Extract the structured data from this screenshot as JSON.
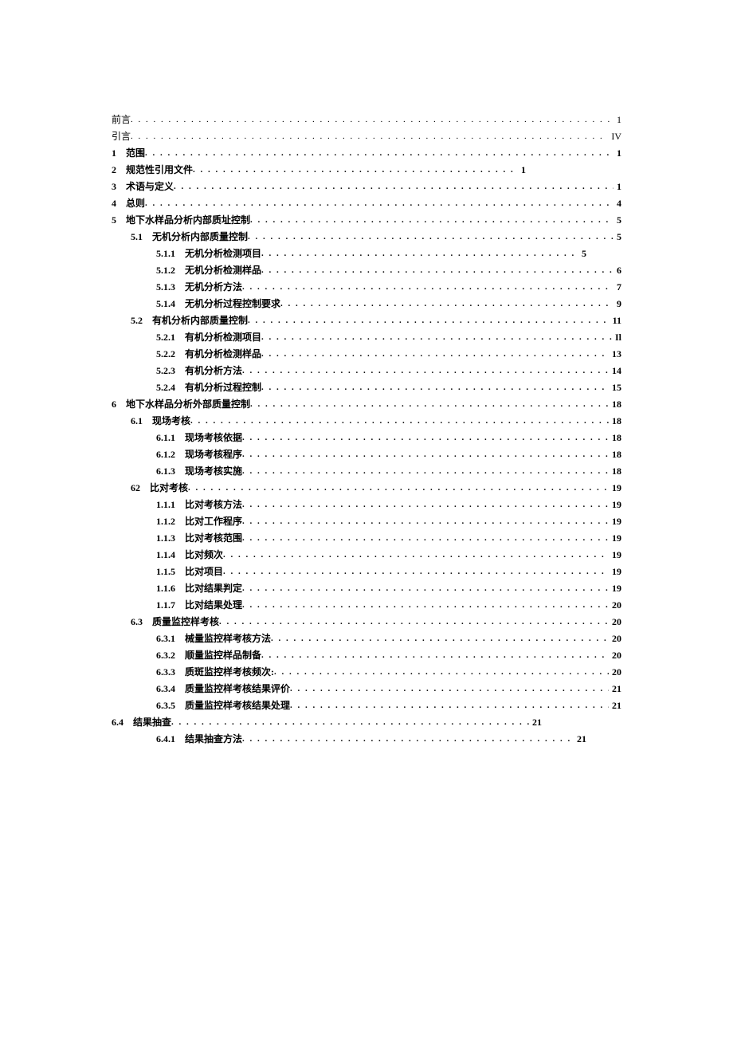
{
  "toc": [
    {
      "num": "",
      "title": "前言",
      "page": "1",
      "level": 0,
      "bold": false,
      "width": ""
    },
    {
      "num": "",
      "title": "引言",
      "page": "IV",
      "level": 0,
      "bold": false,
      "width": ""
    },
    {
      "num": "1",
      "title": "范围",
      "page": "1",
      "level": 0,
      "bold": true,
      "width": ""
    },
    {
      "num": "2",
      "title": "规范性引用文件",
      "page": "1",
      "level": 0,
      "bold": true,
      "width": "short1"
    },
    {
      "num": "3",
      "title": "术语与定义",
      "page": "1",
      "level": 0,
      "bold": true,
      "width": ""
    },
    {
      "num": "4",
      "title": "总则",
      "page": "4",
      "level": 0,
      "bold": true,
      "width": ""
    },
    {
      "num": "5",
      "title": "地下水样品分析内部质址控制",
      "page": "5",
      "level": 0,
      "bold": true,
      "width": ""
    },
    {
      "num": "5.1",
      "title": "无机分析内部质量控制",
      "page": "5",
      "level": 1,
      "bold": true,
      "width": ""
    },
    {
      "num": "5.1.1",
      "title": "无机分析检测项目",
      "page": "5",
      "level": 2,
      "bold": true,
      "width": "short2"
    },
    {
      "num": "5.1.2",
      "title": "无机分析检测样品",
      "page": "6",
      "level": 2,
      "bold": true,
      "width": ""
    },
    {
      "num": "5.1.3",
      "title": "无机分析方法",
      "page": "7",
      "level": 2,
      "bold": true,
      "width": ""
    },
    {
      "num": "5.1.4",
      "title": "无机分析过程控制要求",
      "page": "9",
      "level": 2,
      "bold": true,
      "width": ""
    },
    {
      "num": "5.2",
      "title": "有机分析内部质量控制",
      "page": "11",
      "level": 1,
      "bold": true,
      "width": ""
    },
    {
      "num": "5.2.1",
      "title": "有机分析检测项目",
      "page": "Il",
      "level": 2,
      "bold": true,
      "width": ""
    },
    {
      "num": "5.2.2",
      "title": "有机分析检测样品",
      "page": "13",
      "level": 2,
      "bold": true,
      "width": ""
    },
    {
      "num": "5.2.3",
      "title": "有机分析方法",
      "page": "14",
      "level": 2,
      "bold": true,
      "width": ""
    },
    {
      "num": "5.2.4",
      "title": "有机分析过程控制",
      "page": "15",
      "level": 2,
      "bold": true,
      "width": ""
    },
    {
      "num": "6",
      "title": "地下水样品分析外部质量控制",
      "page": "18",
      "level": 0,
      "bold": true,
      "width": ""
    },
    {
      "num": "6.1",
      "title": "现场考核",
      "page": "18",
      "level": 1,
      "bold": true,
      "width": ""
    },
    {
      "num": "6.1.1",
      "title": "现场考核依据",
      "page": "18",
      "level": 2,
      "bold": true,
      "width": ""
    },
    {
      "num": "6.1.2",
      "title": "现场考核程序",
      "page": "18",
      "level": 2,
      "bold": true,
      "width": ""
    },
    {
      "num": "6.1.3",
      "title": "现场考核实施",
      "page": "18",
      "level": 2,
      "bold": true,
      "width": ""
    },
    {
      "num": "62",
      "title": "比对考核",
      "page": "19",
      "level": 1,
      "bold": true,
      "width": ""
    },
    {
      "num": "1.1.1",
      "title": "比对考核方法",
      "page": "19",
      "level": 2,
      "bold": true,
      "width": ""
    },
    {
      "num": "1.1.2",
      "title": "比对工作程序",
      "page": "19",
      "level": 2,
      "bold": true,
      "width": ""
    },
    {
      "num": "1.1.3",
      "title": "比对考核范围",
      "page": "19",
      "level": 2,
      "bold": true,
      "width": ""
    },
    {
      "num": "1.1.4",
      "title": "比对频次",
      "page": "19",
      "level": 2,
      "bold": true,
      "width": ""
    },
    {
      "num": "1.1.5",
      "title": "比对项目",
      "page": "19",
      "level": 2,
      "bold": true,
      "width": ""
    },
    {
      "num": "1.1.6",
      "title": "比对结果判定",
      "page": "19",
      "level": 2,
      "bold": true,
      "width": ""
    },
    {
      "num": "1.1.7",
      "title": "比对结果处理",
      "page": "20",
      "level": 2,
      "bold": true,
      "width": ""
    },
    {
      "num": "6.3",
      "title": "质量监控样考核",
      "page": "20",
      "level": 1,
      "bold": true,
      "width": ""
    },
    {
      "num": "6.3.1",
      "title": "械量监控样考核方法",
      "page": "20",
      "level": 2,
      "bold": true,
      "width": ""
    },
    {
      "num": "6.3.2",
      "title": "顺量监控样品制备",
      "page": "20",
      "level": 2,
      "bold": true,
      "width": ""
    },
    {
      "num": "6.3.3",
      "title": "质斑监控样考核频次:",
      "page": "20",
      "level": 2,
      "bold": true,
      "width": ""
    },
    {
      "num": "6.3.4",
      "title": "质量监控样考核结果评价",
      "page": "21",
      "level": 2,
      "bold": true,
      "width": ""
    },
    {
      "num": "6.3.5",
      "title": "质量监控样考核结果处理",
      "page": "21",
      "level": 2,
      "bold": true,
      "width": ""
    },
    {
      "num": "6.4",
      "title": "结果抽查",
      "page": "21",
      "level": 0,
      "bold": true,
      "width": "short2"
    },
    {
      "num": "6.4.1",
      "title": "结果抽查方法",
      "page": "21",
      "level": 2,
      "bold": true,
      "width": "short2"
    }
  ]
}
